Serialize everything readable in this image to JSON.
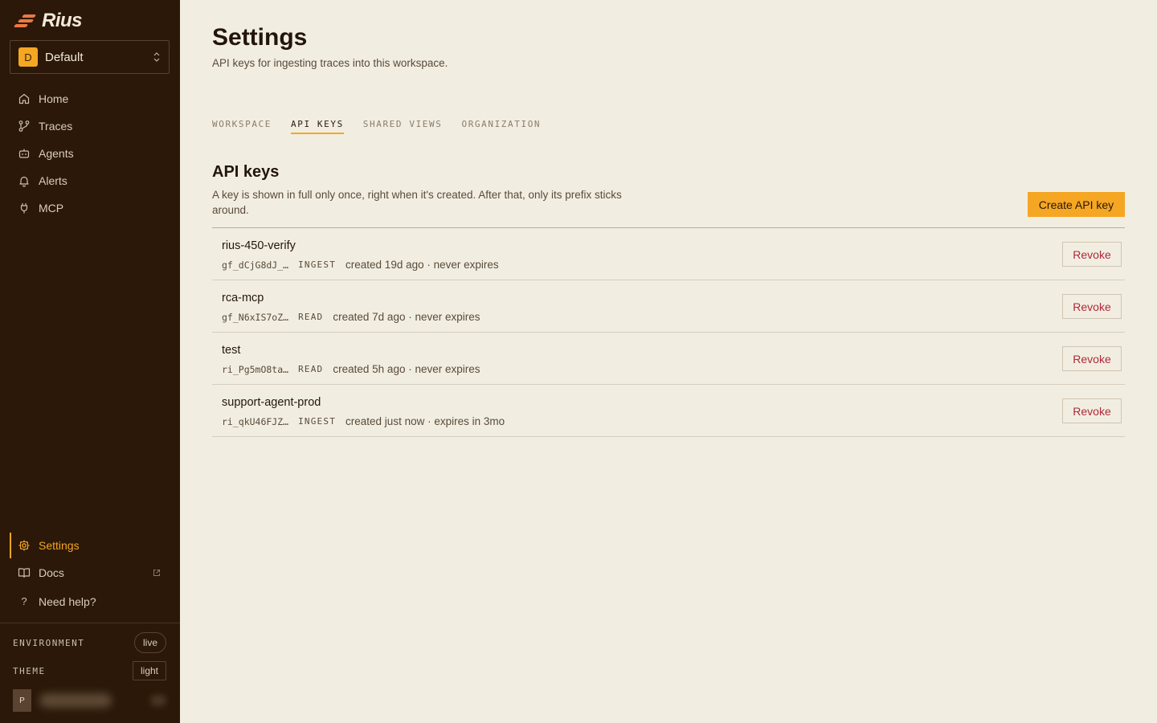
{
  "app": {
    "name": "Rius"
  },
  "workspace": {
    "initial": "D",
    "name": "Default"
  },
  "nav": {
    "items": [
      {
        "label": "Home",
        "icon": "home-icon"
      },
      {
        "label": "Traces",
        "icon": "traces-icon"
      },
      {
        "label": "Agents",
        "icon": "agents-icon"
      },
      {
        "label": "Alerts",
        "icon": "bell-icon"
      },
      {
        "label": "MCP",
        "icon": "plug-icon"
      }
    ],
    "bottom": [
      {
        "label": "Settings",
        "icon": "gear-icon",
        "active": true
      },
      {
        "label": "Docs",
        "icon": "book-icon"
      },
      {
        "label": "Need help?",
        "icon": "question-icon"
      }
    ]
  },
  "environment": {
    "label": "ENVIRONMENT",
    "value": "live"
  },
  "theme": {
    "label": "THEME",
    "value": "light"
  },
  "user": {
    "initial": "P"
  },
  "page": {
    "title": "Settings",
    "subtitle": "API keys for ingesting traces into this workspace."
  },
  "tabs": [
    {
      "label": "WORKSPACE",
      "active": false
    },
    {
      "label": "API KEYS",
      "active": true
    },
    {
      "label": "SHARED VIEWS",
      "active": false
    },
    {
      "label": "ORGANIZATION",
      "active": false
    }
  ],
  "section": {
    "title": "API keys",
    "description": "A key is shown in full only once, right when it's created. After that, only its prefix sticks around.",
    "create_label": "Create API key"
  },
  "keys": [
    {
      "name": "rius-450-verify",
      "prefix": "gf_dCjG8dJ_…",
      "scope": "INGEST",
      "info": "created 19d ago · never expires",
      "action": "Revoke"
    },
    {
      "name": "rca-mcp",
      "prefix": "gf_N6xIS7oZ…",
      "scope": "READ",
      "info": "created 7d ago · never expires",
      "action": "Revoke"
    },
    {
      "name": "test",
      "prefix": "ri_Pg5mO8ta…",
      "scope": "READ",
      "info": "created 5h ago · never expires",
      "action": "Revoke"
    },
    {
      "name": "support-agent-prod",
      "prefix": "ri_qkU46FJZ…",
      "scope": "INGEST",
      "info": "created just now · expires in 3mo",
      "action": "Revoke"
    }
  ],
  "colors": {
    "sidebar_bg": "#2b1808",
    "accent": "#f5a623",
    "page_bg": "#f1eee1",
    "danger": "#b0283a"
  }
}
